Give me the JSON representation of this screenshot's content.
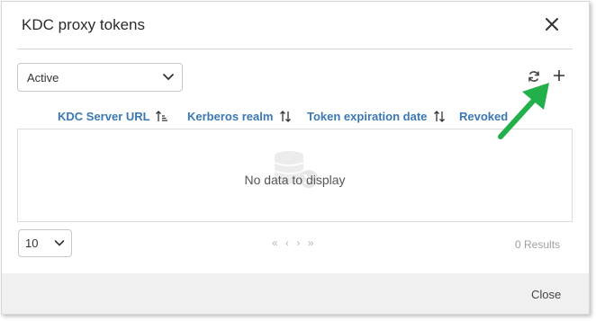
{
  "dialog": {
    "title": "KDC proxy tokens",
    "close_label": "Close"
  },
  "filter": {
    "selected": "Active"
  },
  "toolbar": {
    "refresh_icon": "refresh-icon",
    "add_icon": "plus-icon"
  },
  "table": {
    "columns": [
      {
        "label": "KDC Server URL"
      },
      {
        "label": "Kerberos realm"
      },
      {
        "label": "Token expiration date"
      },
      {
        "label": "Revoked"
      }
    ],
    "empty_message": "No data to display"
  },
  "pagination": {
    "page_size": "10",
    "first": "«",
    "prev": "‹",
    "next": "›",
    "last": "»",
    "results": "0 Results"
  },
  "colors": {
    "link": "#3a78b5",
    "arrow": "#22b04b",
    "footer": "#f0f0f0"
  }
}
